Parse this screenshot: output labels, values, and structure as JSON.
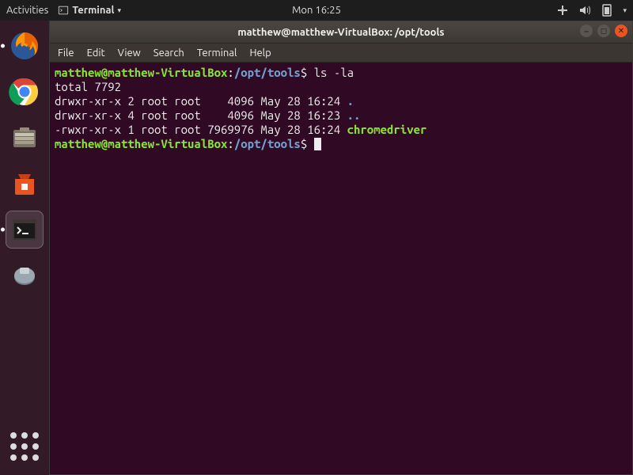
{
  "topbar": {
    "activities": "Activities",
    "app_label": "Terminal",
    "clock": "Mon 16:25"
  },
  "dock": {
    "items": [
      {
        "name": "firefox"
      },
      {
        "name": "chrome"
      },
      {
        "name": "files"
      },
      {
        "name": "software"
      },
      {
        "name": "terminal",
        "active": true
      },
      {
        "name": "settings"
      }
    ],
    "show_apps": "Show Applications"
  },
  "window": {
    "title": "matthew@matthew-VirtualBox: /opt/tools",
    "menu": [
      "File",
      "Edit",
      "View",
      "Search",
      "Terminal",
      "Help"
    ]
  },
  "terminal": {
    "prompt_user": "matthew@matthew-VirtualBox",
    "prompt_path": "/opt/tools",
    "prompt_sep": ":",
    "prompt_end": "$",
    "command": "ls -la",
    "output": {
      "total": "total 7792",
      "rows": [
        {
          "perm": "drwxr-xr-x",
          "n": "2",
          "own": "root",
          "grp": "root",
          "size": "4096",
          "date": "May 28 16:24",
          "name": ".",
          "kind": "dir"
        },
        {
          "perm": "drwxr-xr-x",
          "n": "4",
          "own": "root",
          "grp": "root",
          "size": "4096",
          "date": "May 28 16:23",
          "name": "..",
          "kind": "dir"
        },
        {
          "perm": "-rwxr-xr-x",
          "n": "1",
          "own": "root",
          "grp": "root",
          "size": "7969976",
          "date": "May 28 16:24",
          "name": "chromedriver",
          "kind": "exec"
        }
      ]
    }
  }
}
